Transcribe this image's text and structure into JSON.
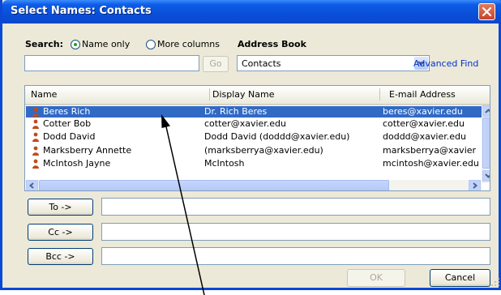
{
  "window": {
    "title": "Select Names: Contacts"
  },
  "search": {
    "label": "Search:",
    "options": [
      "Name only",
      "More columns"
    ],
    "selected": "Name only",
    "value": "",
    "go_label": "Go"
  },
  "address_book": {
    "label": "Address Book",
    "selected": "Contacts",
    "advanced_find_label": "Advanced Find"
  },
  "list": {
    "columns": [
      "Name",
      "Display Name",
      "E-mail Address"
    ],
    "rows": [
      {
        "name": "Beres Rich",
        "display": "Dr. Rich Beres",
        "email": "beres@xavier.edu",
        "selected": true
      },
      {
        "name": "Cotter Bob",
        "display": "cotter@xavier.edu",
        "email": "cotter@xavier.edu",
        "selected": false
      },
      {
        "name": "Dodd David",
        "display": "Dodd David (doddd@xavier.edu)",
        "email": "doddd@xavier.edu",
        "selected": false
      },
      {
        "name": "Marksberry Annette",
        "display": " (marksberrya@xavier.edu)",
        "email": "marksberrya@xavier",
        "selected": false
      },
      {
        "name": "McIntosh Jayne",
        "display": "McIntosh",
        "email": "mcintosh@xavier.edu",
        "selected": false
      }
    ],
    "person_icon_color": "#c04b1b",
    "selection_color": "#316ac5"
  },
  "recipients": {
    "to_label": "To ->",
    "cc_label": "Cc ->",
    "bcc_label": "Bcc ->",
    "to_value": "",
    "cc_value": "",
    "bcc_value": ""
  },
  "footer": {
    "ok_label": "OK",
    "cancel_label": "Cancel"
  },
  "annotation": "arrow-pointing-to-selected-contact"
}
